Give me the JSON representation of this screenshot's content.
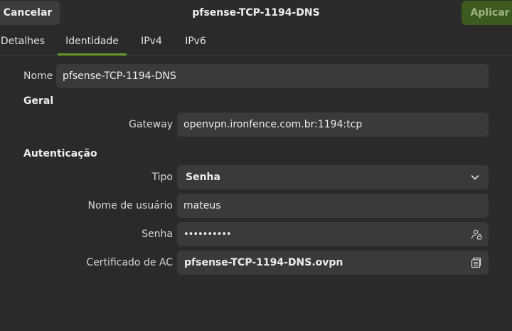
{
  "header": {
    "cancel_label": "Cancelar",
    "title": "pfsense-TCP-1194-DNS",
    "apply_label": "Aplicar"
  },
  "tabs": [
    {
      "label": "Detalhes"
    },
    {
      "label": "Identidade",
      "active": true
    },
    {
      "label": "IPv4"
    },
    {
      "label": "IPv6"
    }
  ],
  "form": {
    "name_label": "Nome",
    "name_value": "pfsense-TCP-1194-DNS",
    "general_section": "Geral",
    "gateway_label": "Gateway",
    "gateway_value": "openvpn.ironfence.com.br:1194:tcp",
    "auth_section": "Autenticação",
    "type_label": "Tipo",
    "type_value": "Senha",
    "username_label": "Nome de usuário",
    "username_value": "mateus",
    "password_label": "Senha",
    "password_value": "••••••••••",
    "ca_label": "Certificado de AC",
    "ca_value": "pfsense-TCP-1194-DNS.ovpn"
  },
  "colors": {
    "accent": "#6a9a2a",
    "apply_bg": "#3d5a1e",
    "field_bg": "#3a3a3a",
    "window_bg": "#2a2a2a"
  },
  "icons": {
    "type_dropdown": "chevron-down-icon",
    "password_toggle": "user-lock-icon",
    "ca_picker": "file-chooser-icon"
  }
}
